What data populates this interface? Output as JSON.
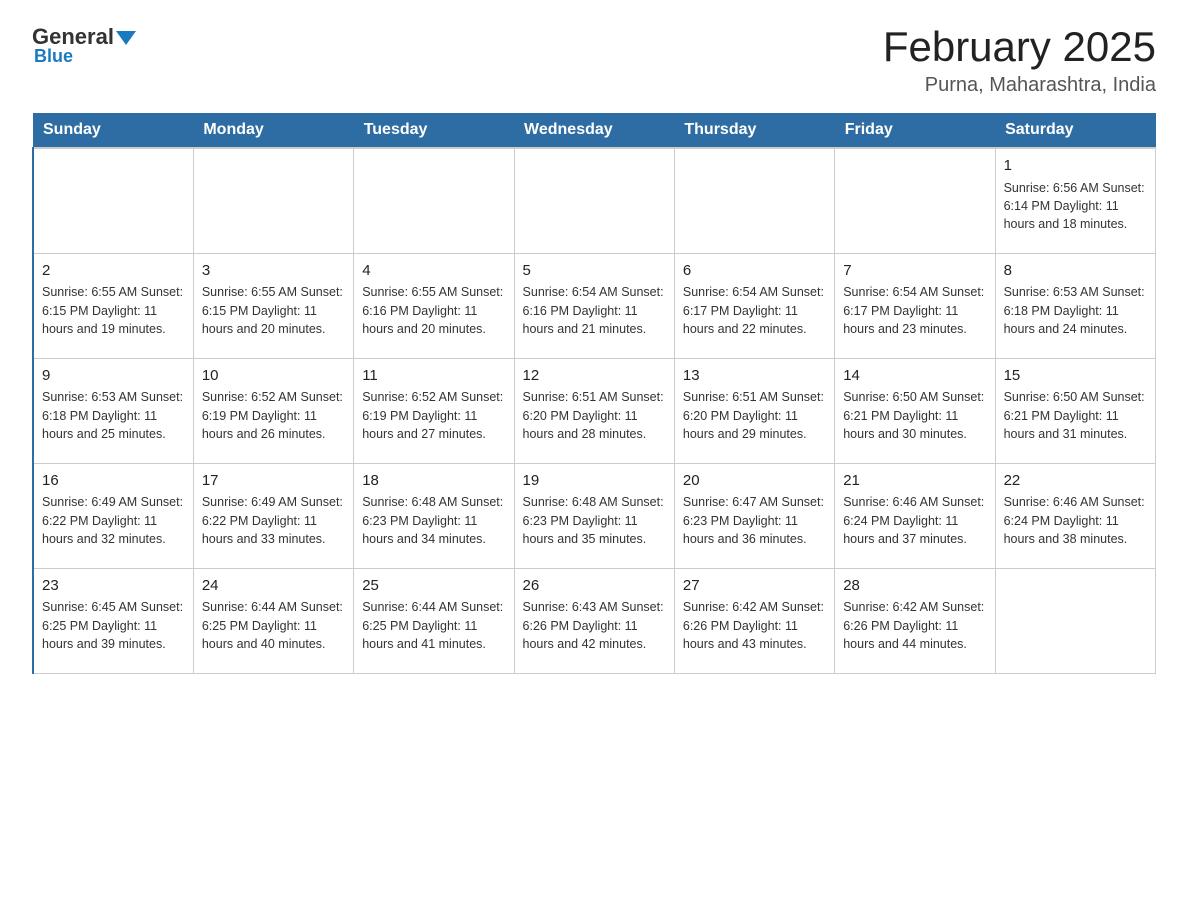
{
  "header": {
    "logo_general": "General",
    "logo_blue": "Blue",
    "title": "February 2025",
    "subtitle": "Purna, Maharashtra, India"
  },
  "weekdays": [
    "Sunday",
    "Monday",
    "Tuesday",
    "Wednesday",
    "Thursday",
    "Friday",
    "Saturday"
  ],
  "weeks": [
    [
      {
        "day": "",
        "info": ""
      },
      {
        "day": "",
        "info": ""
      },
      {
        "day": "",
        "info": ""
      },
      {
        "day": "",
        "info": ""
      },
      {
        "day": "",
        "info": ""
      },
      {
        "day": "",
        "info": ""
      },
      {
        "day": "1",
        "info": "Sunrise: 6:56 AM\nSunset: 6:14 PM\nDaylight: 11 hours and 18 minutes."
      }
    ],
    [
      {
        "day": "2",
        "info": "Sunrise: 6:55 AM\nSunset: 6:15 PM\nDaylight: 11 hours and 19 minutes."
      },
      {
        "day": "3",
        "info": "Sunrise: 6:55 AM\nSunset: 6:15 PM\nDaylight: 11 hours and 20 minutes."
      },
      {
        "day": "4",
        "info": "Sunrise: 6:55 AM\nSunset: 6:16 PM\nDaylight: 11 hours and 20 minutes."
      },
      {
        "day": "5",
        "info": "Sunrise: 6:54 AM\nSunset: 6:16 PM\nDaylight: 11 hours and 21 minutes."
      },
      {
        "day": "6",
        "info": "Sunrise: 6:54 AM\nSunset: 6:17 PM\nDaylight: 11 hours and 22 minutes."
      },
      {
        "day": "7",
        "info": "Sunrise: 6:54 AM\nSunset: 6:17 PM\nDaylight: 11 hours and 23 minutes."
      },
      {
        "day": "8",
        "info": "Sunrise: 6:53 AM\nSunset: 6:18 PM\nDaylight: 11 hours and 24 minutes."
      }
    ],
    [
      {
        "day": "9",
        "info": "Sunrise: 6:53 AM\nSunset: 6:18 PM\nDaylight: 11 hours and 25 minutes."
      },
      {
        "day": "10",
        "info": "Sunrise: 6:52 AM\nSunset: 6:19 PM\nDaylight: 11 hours and 26 minutes."
      },
      {
        "day": "11",
        "info": "Sunrise: 6:52 AM\nSunset: 6:19 PM\nDaylight: 11 hours and 27 minutes."
      },
      {
        "day": "12",
        "info": "Sunrise: 6:51 AM\nSunset: 6:20 PM\nDaylight: 11 hours and 28 minutes."
      },
      {
        "day": "13",
        "info": "Sunrise: 6:51 AM\nSunset: 6:20 PM\nDaylight: 11 hours and 29 minutes."
      },
      {
        "day": "14",
        "info": "Sunrise: 6:50 AM\nSunset: 6:21 PM\nDaylight: 11 hours and 30 minutes."
      },
      {
        "day": "15",
        "info": "Sunrise: 6:50 AM\nSunset: 6:21 PM\nDaylight: 11 hours and 31 minutes."
      }
    ],
    [
      {
        "day": "16",
        "info": "Sunrise: 6:49 AM\nSunset: 6:22 PM\nDaylight: 11 hours and 32 minutes."
      },
      {
        "day": "17",
        "info": "Sunrise: 6:49 AM\nSunset: 6:22 PM\nDaylight: 11 hours and 33 minutes."
      },
      {
        "day": "18",
        "info": "Sunrise: 6:48 AM\nSunset: 6:23 PM\nDaylight: 11 hours and 34 minutes."
      },
      {
        "day": "19",
        "info": "Sunrise: 6:48 AM\nSunset: 6:23 PM\nDaylight: 11 hours and 35 minutes."
      },
      {
        "day": "20",
        "info": "Sunrise: 6:47 AM\nSunset: 6:23 PM\nDaylight: 11 hours and 36 minutes."
      },
      {
        "day": "21",
        "info": "Sunrise: 6:46 AM\nSunset: 6:24 PM\nDaylight: 11 hours and 37 minutes."
      },
      {
        "day": "22",
        "info": "Sunrise: 6:46 AM\nSunset: 6:24 PM\nDaylight: 11 hours and 38 minutes."
      }
    ],
    [
      {
        "day": "23",
        "info": "Sunrise: 6:45 AM\nSunset: 6:25 PM\nDaylight: 11 hours and 39 minutes."
      },
      {
        "day": "24",
        "info": "Sunrise: 6:44 AM\nSunset: 6:25 PM\nDaylight: 11 hours and 40 minutes."
      },
      {
        "day": "25",
        "info": "Sunrise: 6:44 AM\nSunset: 6:25 PM\nDaylight: 11 hours and 41 minutes."
      },
      {
        "day": "26",
        "info": "Sunrise: 6:43 AM\nSunset: 6:26 PM\nDaylight: 11 hours and 42 minutes."
      },
      {
        "day": "27",
        "info": "Sunrise: 6:42 AM\nSunset: 6:26 PM\nDaylight: 11 hours and 43 minutes."
      },
      {
        "day": "28",
        "info": "Sunrise: 6:42 AM\nSunset: 6:26 PM\nDaylight: 11 hours and 44 minutes."
      },
      {
        "day": "",
        "info": ""
      }
    ]
  ]
}
